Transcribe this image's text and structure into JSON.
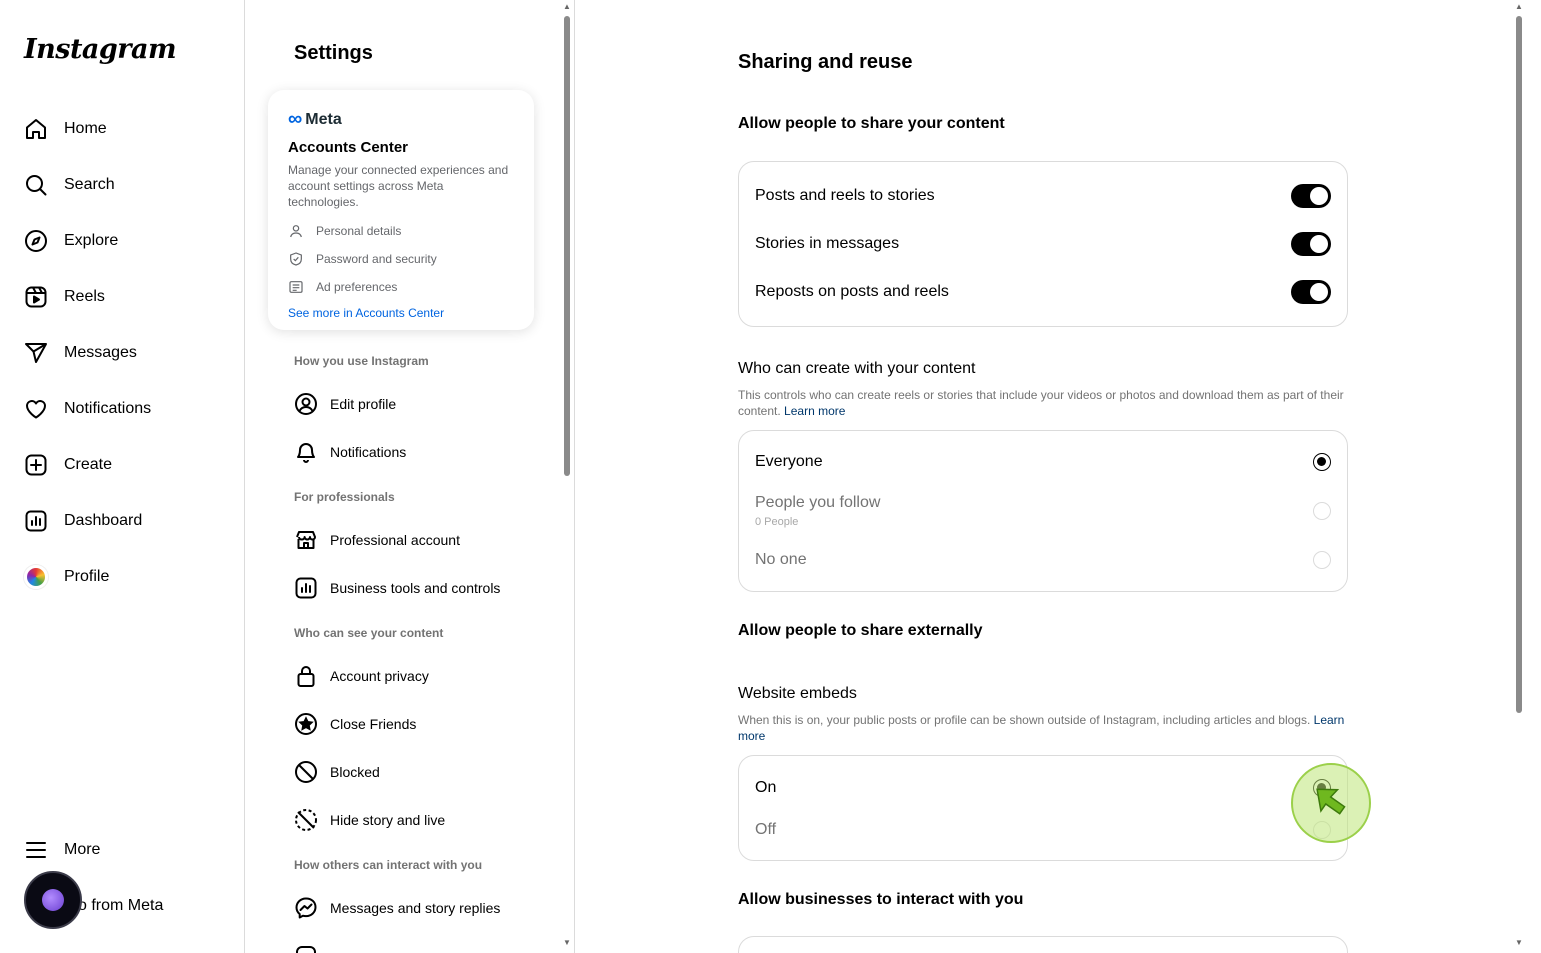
{
  "app": {
    "logo": "Instagram"
  },
  "nav": {
    "items": [
      {
        "label": "Home",
        "icon": "home-icon"
      },
      {
        "label": "Search",
        "icon": "search-icon"
      },
      {
        "label": "Explore",
        "icon": "explore-icon"
      },
      {
        "label": "Reels",
        "icon": "reels-icon"
      },
      {
        "label": "Messages",
        "icon": "messages-icon"
      },
      {
        "label": "Notifications",
        "icon": "heart-icon"
      },
      {
        "label": "Create",
        "icon": "plus-square-icon"
      },
      {
        "label": "Dashboard",
        "icon": "dashboard-icon"
      },
      {
        "label": "Profile",
        "icon": "avatar"
      }
    ],
    "more": "More",
    "also_from_meta": "so from Meta"
  },
  "settings": {
    "title": "Settings",
    "accounts_center": {
      "brand": "Meta",
      "title": "Accounts Center",
      "description": "Manage your connected experiences and account settings across Meta technologies.",
      "rows": [
        "Personal details",
        "Password and security",
        "Ad preferences"
      ],
      "link": "See more in Accounts Center"
    },
    "sections": {
      "how_you_use": "How you use Instagram",
      "for_professionals": "For professionals",
      "who_can_see": "Who can see your content",
      "how_others": "How others can interact with you"
    },
    "items": {
      "edit_profile": "Edit profile",
      "notifications": "Notifications",
      "professional_account": "Professional account",
      "business_tools": "Business tools and controls",
      "account_privacy": "Account privacy",
      "close_friends": "Close Friends",
      "blocked": "Blocked",
      "hide_story": "Hide story and live",
      "messages_replies": "Messages and story replies"
    }
  },
  "main": {
    "title": "Sharing and reuse",
    "share_content": {
      "heading": "Allow people to share your content",
      "toggles": [
        {
          "label": "Posts and reels to stories",
          "on": true
        },
        {
          "label": "Stories in messages",
          "on": true
        },
        {
          "label": "Reposts on posts and reels",
          "on": true
        }
      ]
    },
    "create_with": {
      "heading": "Who can create with your content",
      "description": "This controls who can create reels or stories that include your videos or photos and download them as part of their content.",
      "learn_more": "Learn more",
      "options": [
        {
          "label": "Everyone",
          "selected": true
        },
        {
          "label": "People you follow",
          "sub": "0 People",
          "selected": false
        },
        {
          "label": "No one",
          "selected": false
        }
      ]
    },
    "share_external": {
      "heading": "Allow people to share externally"
    },
    "website_embeds": {
      "heading": "Website embeds",
      "description": "When this is on, your public posts or profile can be shown outside of Instagram, including articles and blogs.",
      "learn_more": "Learn more",
      "options": [
        {
          "label": "On",
          "selected": true
        },
        {
          "label": "Off",
          "selected": false
        }
      ]
    },
    "businesses": {
      "heading": "Allow businesses to interact with you"
    }
  }
}
